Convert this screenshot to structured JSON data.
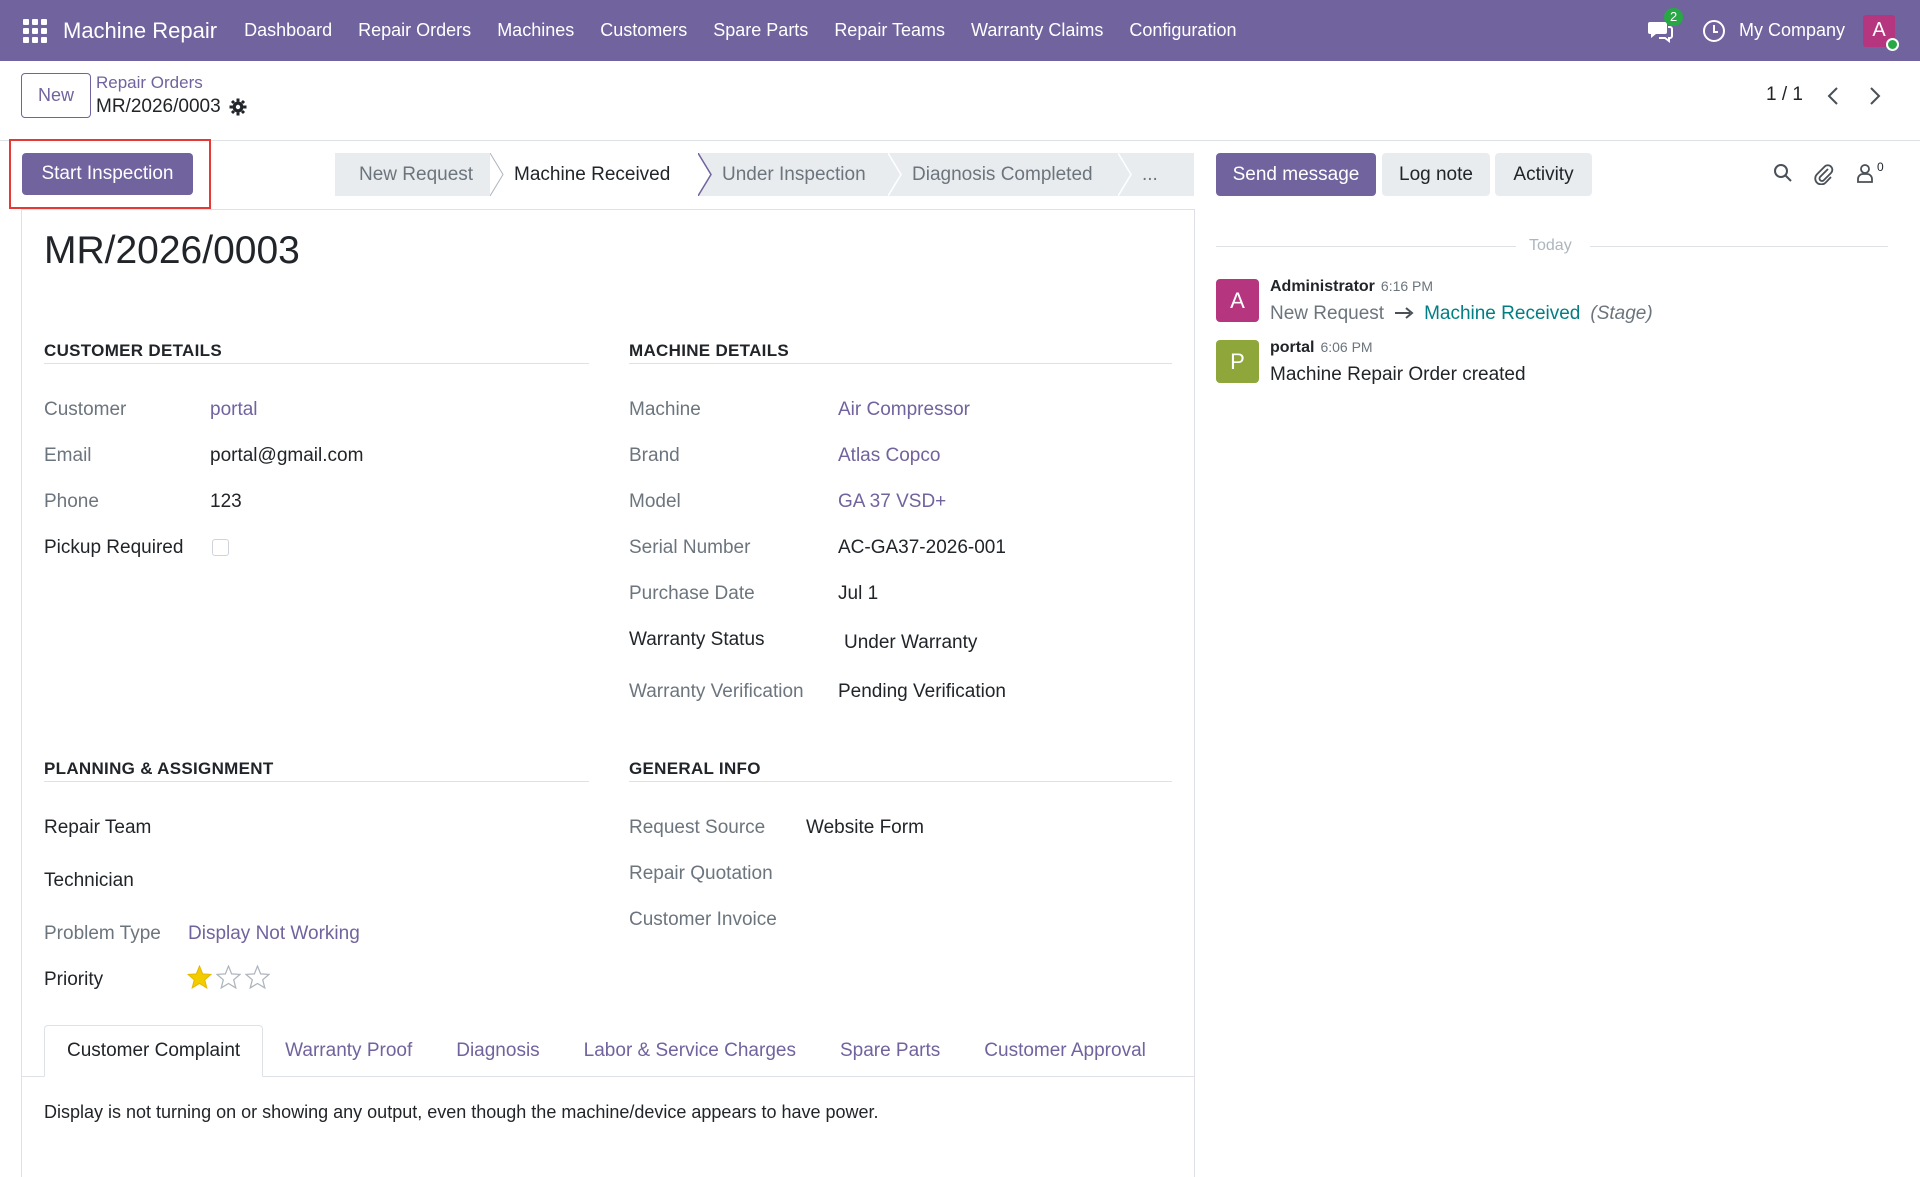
{
  "navbar": {
    "app_name": "Machine Repair",
    "menu": [
      "Dashboard",
      "Repair Orders",
      "Machines",
      "Customers",
      "Spare Parts",
      "Repair Teams",
      "Warranty Claims",
      "Configuration"
    ],
    "messages_badge": "2",
    "company": "My Company",
    "user_initial": "A",
    "brand_color": "#71639e"
  },
  "control_panel": {
    "new_label": "New",
    "breadcrumb_parent": "Repair Orders",
    "breadcrumb_current": "MR/2026/0003",
    "pager": "1 / 1"
  },
  "header": {
    "start_inspection_label": "Start Inspection",
    "stages": [
      "New Request",
      "Machine Received",
      "Under Inspection",
      "Diagnosis Completed",
      "..."
    ],
    "active_stage": "Machine Received"
  },
  "chatter_buttons": {
    "send_message": "Send message",
    "log_note": "Log note",
    "activity": "Activity",
    "followers_count": "0"
  },
  "form": {
    "name": "MR/2026/0003",
    "customer_details": {
      "title": "CUSTOMER DETAILS",
      "customer_label": "Customer",
      "customer_value": "portal",
      "email_label": "Email",
      "email_value": "portal@gmail.com",
      "phone_label": "Phone",
      "phone_value": "123",
      "pickup_label": "Pickup Required",
      "pickup_checked": false
    },
    "machine_details": {
      "title": "MACHINE DETAILS",
      "machine_label": "Machine",
      "machine_value": "Air Compressor",
      "brand_label": "Brand",
      "brand_value": "Atlas Copco",
      "model_label": "Model",
      "model_value": "GA 37 VSD+",
      "serial_label": "Serial Number",
      "serial_value": "AC-GA37-2026-001",
      "purchase_label": "Purchase Date",
      "purchase_value": "Jul 1",
      "warranty_status_label": "Warranty Status",
      "warranty_status_value": "Under Warranty",
      "warranty_verif_label": "Warranty Verification",
      "warranty_verif_value": "Pending Verification"
    },
    "planning": {
      "title": "PLANNING & ASSIGNMENT",
      "team_label": "Repair Team",
      "technician_label": "Technician",
      "problem_label": "Problem Type",
      "problem_value": "Display Not Working",
      "priority_label": "Priority",
      "priority_stars": 1
    },
    "general": {
      "title": "GENERAL INFO",
      "source_label": "Request Source",
      "source_value": "Website Form",
      "quotation_label": "Repair Quotation",
      "invoice_label": "Customer Invoice"
    },
    "tabs": [
      "Customer Complaint",
      "Warranty Proof",
      "Diagnosis",
      "Labor & Service Charges",
      "Spare Parts",
      "Customer Approval"
    ],
    "complaint_text": "Display is not turning on or showing any output, even though the machine/device appears to have power."
  },
  "chatter": {
    "date_separator": "Today",
    "messages": [
      {
        "initial": "A",
        "author": "Administrator",
        "time": "6:16 PM",
        "from": "New Request",
        "to": "Machine Received",
        "field": "(Stage)",
        "avatar_color": "#b5357f"
      },
      {
        "initial": "P",
        "author": "portal",
        "time": "6:06 PM",
        "body": "Machine Repair Order created",
        "avatar_color": "#8ea63a"
      }
    ]
  }
}
